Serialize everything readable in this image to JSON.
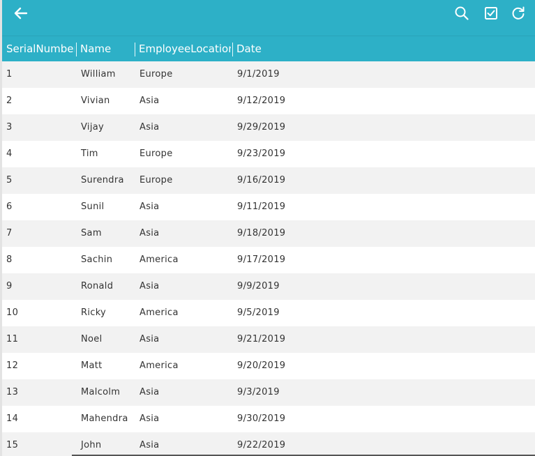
{
  "toolbar": {
    "back_icon": "arrow-left-icon",
    "search_icon": "search-icon",
    "select_icon": "checkbox-icon",
    "refresh_icon": "refresh-icon",
    "accent_color": "#2db0c7"
  },
  "grid": {
    "columns": [
      "SerialNumber",
      "Name",
      "EmployeeLocation",
      "Date"
    ],
    "rows": [
      [
        "1",
        "William",
        "Europe",
        "9/1/2019"
      ],
      [
        "2",
        "Vivian",
        "Asia",
        "9/12/2019"
      ],
      [
        "3",
        "Vijay",
        "Asia",
        "9/29/2019"
      ],
      [
        "4",
        "Tim",
        "Europe",
        "9/23/2019"
      ],
      [
        "5",
        "Surendra",
        "Europe",
        "9/16/2019"
      ],
      [
        "6",
        "Sunil",
        "Asia",
        "9/11/2019"
      ],
      [
        "7",
        "Sam",
        "Asia",
        "9/18/2019"
      ],
      [
        "8",
        "Sachin",
        "America",
        "9/17/2019"
      ],
      [
        "9",
        "Ronald",
        "Asia",
        "9/9/2019"
      ],
      [
        "10",
        "Ricky",
        "America",
        "9/5/2019"
      ],
      [
        "11",
        "Noel",
        "Asia",
        "9/21/2019"
      ],
      [
        "12",
        "Matt",
        "America",
        "9/20/2019"
      ],
      [
        "13",
        "Malcolm",
        "Asia",
        "9/3/2019"
      ],
      [
        "14",
        "Mahendra",
        "Asia",
        "9/30/2019"
      ],
      [
        "15",
        "John",
        "Asia",
        "9/22/2019"
      ]
    ]
  }
}
